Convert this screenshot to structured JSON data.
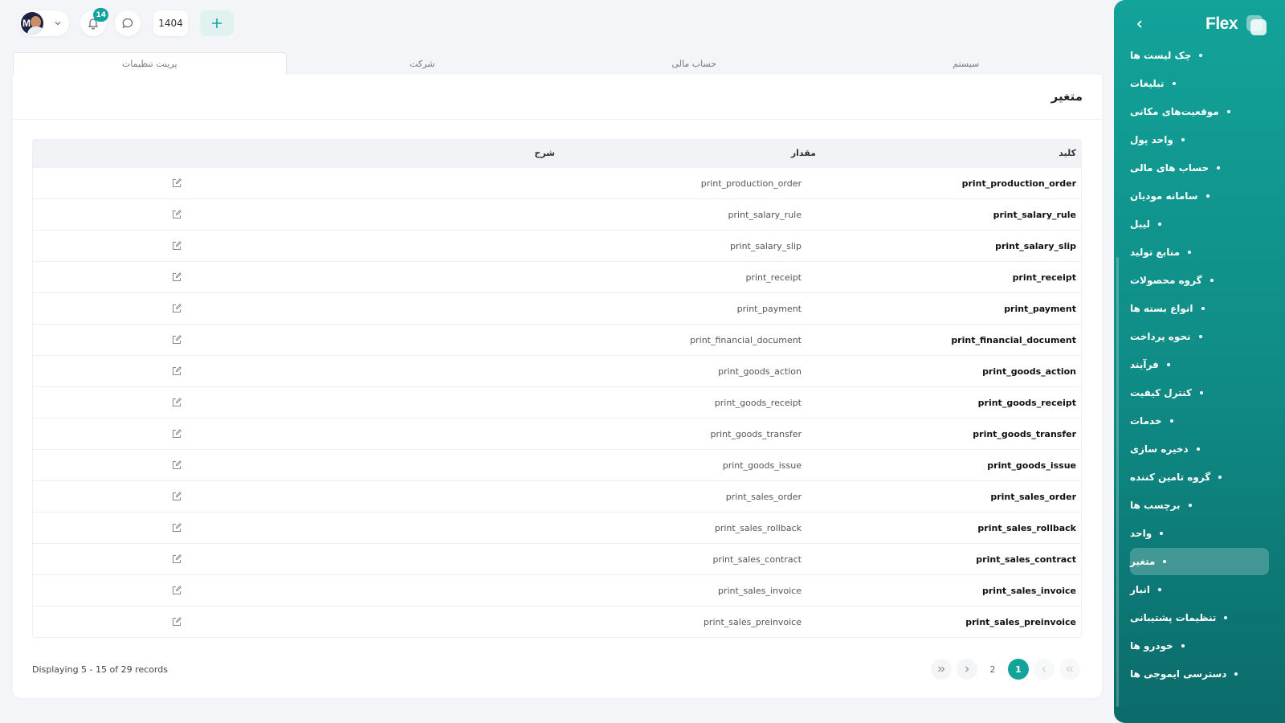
{
  "brand": {
    "name": "Flex"
  },
  "topbar": {
    "notifications_count": "14",
    "year": "1404"
  },
  "sidebar": {
    "items": [
      {
        "label": "چک لیست ها"
      },
      {
        "label": "تبلیغات"
      },
      {
        "label": "موقعیت‌های مکانی"
      },
      {
        "label": "واحد پول"
      },
      {
        "label": "حساب های مالی"
      },
      {
        "label": "سامانه مودیان"
      },
      {
        "label": "لیبل"
      },
      {
        "label": "منابع تولید"
      },
      {
        "label": "گروه محصولات"
      },
      {
        "label": "انواع بسته ها"
      },
      {
        "label": "نحوه پرداخت"
      },
      {
        "label": "فرآیند"
      },
      {
        "label": "کنترل کیفیت"
      },
      {
        "label": "خدمات"
      },
      {
        "label": "ذخیره سازی"
      },
      {
        "label": "گروه تامین کننده"
      },
      {
        "label": "برچسب ها"
      },
      {
        "label": "واحد"
      },
      {
        "label": "متغیر",
        "active": true
      },
      {
        "label": "انبار"
      },
      {
        "label": "تنظیمات پشتیبانی"
      },
      {
        "label": "خودرو ها"
      },
      {
        "label": "دسترسی ایموجی ها"
      }
    ]
  },
  "tabs": [
    {
      "label": "سیستم",
      "active": false
    },
    {
      "label": "حساب مالی",
      "active": false
    },
    {
      "label": "شرکت",
      "active": false
    },
    {
      "label": "پرینت تنظیمات",
      "active": true
    }
  ],
  "page": {
    "title": "متغیر"
  },
  "table": {
    "headers": {
      "key": "کلید",
      "value": "مقدار",
      "description": "شرح"
    },
    "rows": [
      {
        "key": "print_production_order",
        "value": "print_production_order"
      },
      {
        "key": "print_salary_rule",
        "value": "print_salary_rule"
      },
      {
        "key": "print_salary_slip",
        "value": "print_salary_slip"
      },
      {
        "key": "print_receipt",
        "value": "print_receipt"
      },
      {
        "key": "print_payment",
        "value": "print_payment"
      },
      {
        "key": "print_financial_document",
        "value": "print_financial_document"
      },
      {
        "key": "print_goods_action",
        "value": "print_goods_action"
      },
      {
        "key": "print_goods_receipt",
        "value": "print_goods_receipt"
      },
      {
        "key": "print_goods_transfer",
        "value": "print_goods_transfer"
      },
      {
        "key": "print_goods_issue",
        "value": "print_goods_issue"
      },
      {
        "key": "print_sales_order",
        "value": "print_sales_order"
      },
      {
        "key": "print_sales_rollback",
        "value": "print_sales_rollback"
      },
      {
        "key": "print_sales_contract",
        "value": "print_sales_contract"
      },
      {
        "key": "print_sales_invoice",
        "value": "print_sales_invoice"
      },
      {
        "key": "print_sales_preinvoice",
        "value": "print_sales_preinvoice"
      }
    ]
  },
  "footer": {
    "records_text": "Displaying 5 - 15 of 29 records"
  },
  "pagination": {
    "pages": [
      "2",
      "1"
    ],
    "current": "1"
  },
  "colors": {
    "accent": "#12a39a",
    "sidebar_dark": "#0b6b6a",
    "background": "#f3f5f8"
  }
}
